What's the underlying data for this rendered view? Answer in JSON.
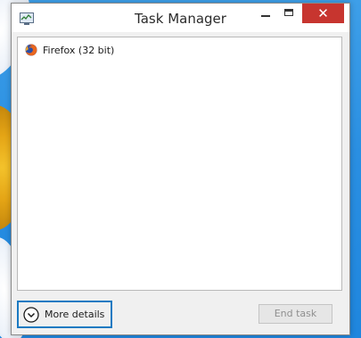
{
  "window": {
    "title": "Task Manager",
    "close_glyph": "✕"
  },
  "processes": [
    {
      "name": "Firefox (32 bit)",
      "icon": "firefox-icon"
    }
  ],
  "footer": {
    "more_details_label": "More details",
    "end_task_label": "End task",
    "end_task_enabled": false
  },
  "colors": {
    "close_button": "#c7352f",
    "focus_outline": "#1b7ac2",
    "desktop_sky": "#2a8fe2"
  }
}
